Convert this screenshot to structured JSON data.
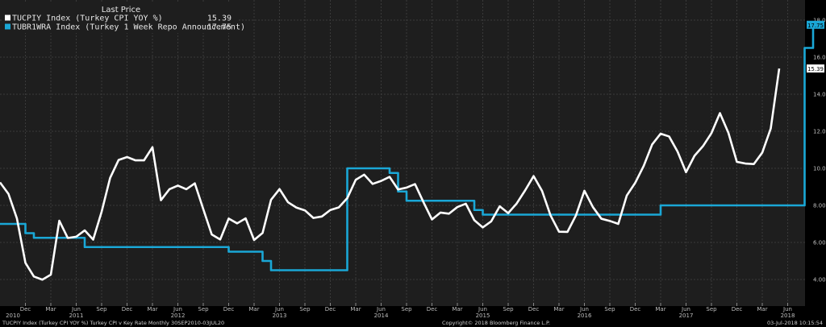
{
  "colors": {
    "background": "#000000",
    "plot_background": "#1e1e1e",
    "grid": "#3a3a3a",
    "cpi": "#ffffff",
    "repo": "#1aa7d6",
    "axis_text": "#bdbdbd"
  },
  "legend": {
    "header": "Last Price",
    "items": [
      {
        "label": "TUCPIY Index (Turkey CPI YOY %)",
        "value": "15.39",
        "color": "#ffffff"
      },
      {
        "label": "TUBR1WRA Index (Turkey 1 Week Repo Announcement)",
        "value": "17.75",
        "color": "#1aa7d6"
      }
    ]
  },
  "footer": {
    "left": "TUCPIY Index (Turkey CPI YOY %) Turkey CPI v Key Rate  Monthly 30SEP2010-03JUL20",
    "center": "Copyright© 2018 Bloomberg Finance L.P.",
    "right": "03-Jul-2018 10:15:54"
  },
  "chart_data": {
    "type": "line",
    "title": "",
    "xlabel": "",
    "ylabel": "",
    "ylim": [
      3.0,
      19.0
    ],
    "y_ticks": [
      "4.00",
      "6.00",
      "8.00",
      "10.00",
      "12.00",
      "14.00",
      "16.00",
      "18.00"
    ],
    "grid": true,
    "legend_position": "top-left",
    "x_month_labels": [
      "Dec",
      "Mar",
      "Jun",
      "Sep",
      "Dec",
      "Mar",
      "Jun",
      "Sep",
      "Dec",
      "Mar",
      "Jun",
      "Sep",
      "Dec",
      "Mar",
      "Jun",
      "Sep",
      "Dec",
      "Mar",
      "Jun",
      "Sep",
      "Dec",
      "Mar",
      "Jun",
      "Sep",
      "Dec",
      "Mar",
      "Jun",
      "Sep",
      "Dec",
      "Mar",
      "Jun"
    ],
    "x_year_labels": [
      "2010",
      "2011",
      "2012",
      "2013",
      "2014",
      "2015",
      "2016",
      "2017",
      "2018"
    ],
    "x_start": "2010-09",
    "series": [
      {
        "name": "TUCPIY Index (Turkey CPI YOY %)",
        "last_value": "15.39",
        "values": [
          9.24,
          8.62,
          7.29,
          4.9,
          4.16,
          3.99,
          4.26,
          7.17,
          6.24,
          6.31,
          6.65,
          6.15,
          7.66,
          9.48,
          10.45,
          10.61,
          10.43,
          10.43,
          11.14,
          8.28,
          8.87,
          9.07,
          8.87,
          9.19,
          7.8,
          6.43,
          6.16,
          7.29,
          7.03,
          7.3,
          6.13,
          6.51,
          8.3,
          8.88,
          8.17,
          7.88,
          7.73,
          7.32,
          7.4,
          7.75,
          7.89,
          8.39,
          9.38,
          9.66,
          9.16,
          9.32,
          9.54,
          8.86,
          8.96,
          9.15,
          8.17,
          7.24,
          7.61,
          7.55,
          7.91,
          8.09,
          7.2,
          6.81,
          7.14,
          7.95,
          7.58,
          8.1,
          8.81,
          9.58,
          8.78,
          7.46,
          6.58,
          6.57,
          7.46,
          8.79,
          7.91,
          7.28,
          7.16,
          7.0,
          8.53,
          9.22,
          10.13,
          11.29,
          11.87,
          11.72,
          10.9,
          9.79,
          10.68,
          11.2,
          11.9,
          12.98,
          11.92,
          10.35,
          10.26,
          10.23,
          10.85,
          12.15,
          15.39
        ]
      },
      {
        "name": "TUBR1WRA Index (Turkey 1 Week Repo Announcement)",
        "last_value": "17.75",
        "values": [
          7.0,
          7.0,
          7.0,
          6.5,
          6.25,
          6.25,
          6.25,
          6.25,
          6.25,
          6.25,
          5.75,
          5.75,
          5.75,
          5.75,
          5.75,
          5.75,
          5.75,
          5.75,
          5.75,
          5.75,
          5.75,
          5.75,
          5.75,
          5.75,
          5.75,
          5.75,
          5.75,
          5.5,
          5.5,
          5.5,
          5.5,
          5.0,
          4.5,
          4.5,
          4.5,
          4.5,
          4.5,
          4.5,
          4.5,
          4.5,
          4.5,
          10.0,
          10.0,
          10.0,
          10.0,
          10.0,
          9.75,
          8.75,
          8.25,
          8.25,
          8.25,
          8.25,
          8.25,
          8.25,
          8.25,
          8.25,
          7.75,
          7.5,
          7.5,
          7.5,
          7.5,
          7.5,
          7.5,
          7.5,
          7.5,
          7.5,
          7.5,
          7.5,
          7.5,
          7.5,
          7.5,
          7.5,
          7.5,
          7.5,
          7.5,
          7.5,
          7.5,
          7.5,
          8.0,
          8.0,
          8.0,
          8.0,
          8.0,
          8.0,
          8.0,
          8.0,
          8.0,
          8.0,
          8.0,
          8.0,
          8.0,
          8.0,
          8.0,
          8.0,
          8.0,
          16.5,
          17.75
        ]
      }
    ]
  }
}
